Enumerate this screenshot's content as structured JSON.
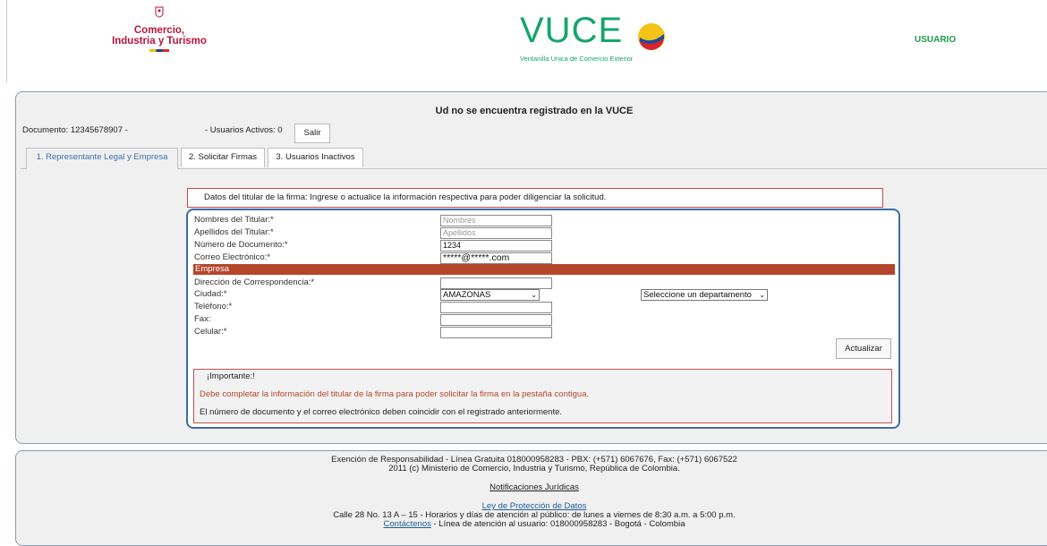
{
  "header": {
    "logo_text_line1": "Comercio,",
    "logo_text_line2": "Industria y Turismo",
    "vuce_title": "VUCE",
    "vuce_subtitle": "Ventanilla Unica de Comercio Exterior",
    "user_label": "USUARIO"
  },
  "panel": {
    "title": "Ud no se encuentra registrado en la VUCE",
    "documento": "Documento: 12345678907 -",
    "usuarios_activos": "- Usuarios Activos: 0",
    "salir_label": "Salir"
  },
  "tabs": [
    {
      "label": "1. Representante Legal y Empresa"
    },
    {
      "label": "2. Solicitar Firmas"
    },
    {
      "label": "3. Usuarios Inactivos"
    }
  ],
  "datos_banner": "Datos del titular de la firma: Ingrese o actualice la información respectiva para poder diligenciar la solicitud.",
  "form": {
    "nombres_label": "Nombres del Titular:*",
    "nombres_placeholder": "Nombres",
    "apellidos_label": "Apellidos del Titular:*",
    "apellidos_placeholder": "Apellidos",
    "numero_label": "Número de Documento:*",
    "numero_value": "1234",
    "correo_label": "Correo Electrónico:*",
    "correo_value": "*****@*****.com",
    "empresa_header": "Empresa",
    "direccion_label": "Dirección de Correspondencia:*",
    "ciudad_label": "Ciudad:*",
    "ciudad_value": "AMAZONAS",
    "departamento_value": "Seleccione un departamento",
    "telefono_label": "Teléfono:*",
    "fax_label": "Fax:",
    "celular_label": "Celular:*",
    "actualizar_label": "Actualizar"
  },
  "importante": {
    "heading": "¡Importante:!",
    "red_text": "Debe completar la información del titular de la firma para poder solicitar la firma en la pestaña contigua.",
    "note": "El número de documento y el correo electrónico deben coincidir con el registrado anteriormente."
  },
  "footer": {
    "line1": "Exención de Responsabilidad - Línea Gratuita 018000958283 - PBX: (+571) 6067676, Fax: (+571) 6067522",
    "line2": "2011 (c) Ministerio de Comercio, Industria y Turismo, República de Colombia.",
    "notificaciones": "Notificaciones Jurídicas",
    "ley": "Ley de Protección de Datos",
    "address": "Calle 28 No. 13 A – 15 - Horarios y días de atención al público: de lunes a viernes de 8:30 a.m. a 5:00 p.m.",
    "contactenos": "Contáctenos",
    "contact_rest": " - Línea de atención al usuario: 018000958283  - Bogotá - Colombia"
  }
}
